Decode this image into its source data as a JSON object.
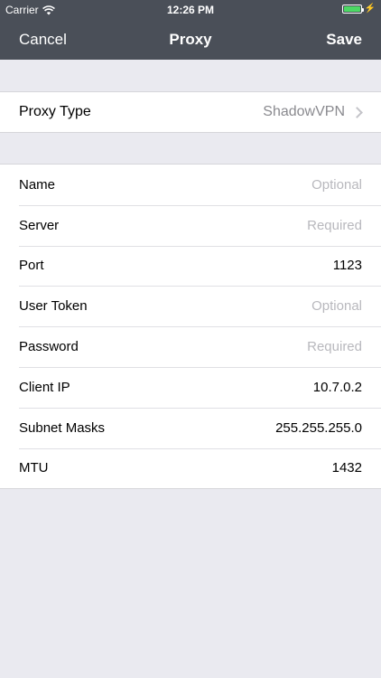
{
  "status_bar": {
    "carrier": "Carrier",
    "time": "12:26 PM",
    "wifi_icon": "wifi-icon",
    "battery_icon": "battery-icon",
    "charging_icon": "bolt-icon",
    "battery_level": 1.0,
    "battery_color": "#4cd964"
  },
  "navbar": {
    "left_label": "Cancel",
    "title": "Proxy",
    "right_label": "Save",
    "background": "#4a4f58"
  },
  "proxy_type": {
    "label": "Proxy Type",
    "value": "ShadowVPN",
    "chevron_icon": "chevron-right-icon"
  },
  "fields": [
    {
      "label": "Name",
      "value": "",
      "placeholder": "Optional"
    },
    {
      "label": "Server",
      "value": "",
      "placeholder": "Required"
    },
    {
      "label": "Port",
      "value": "1123",
      "placeholder": ""
    },
    {
      "label": "User Token",
      "value": "",
      "placeholder": "Optional"
    },
    {
      "label": "Password",
      "value": "",
      "placeholder": "Required"
    },
    {
      "label": "Client IP",
      "value": "10.7.0.2",
      "placeholder": ""
    },
    {
      "label": "Subnet Masks",
      "value": "255.255.255.0",
      "placeholder": ""
    },
    {
      "label": "MTU",
      "value": "1432",
      "placeholder": ""
    }
  ]
}
